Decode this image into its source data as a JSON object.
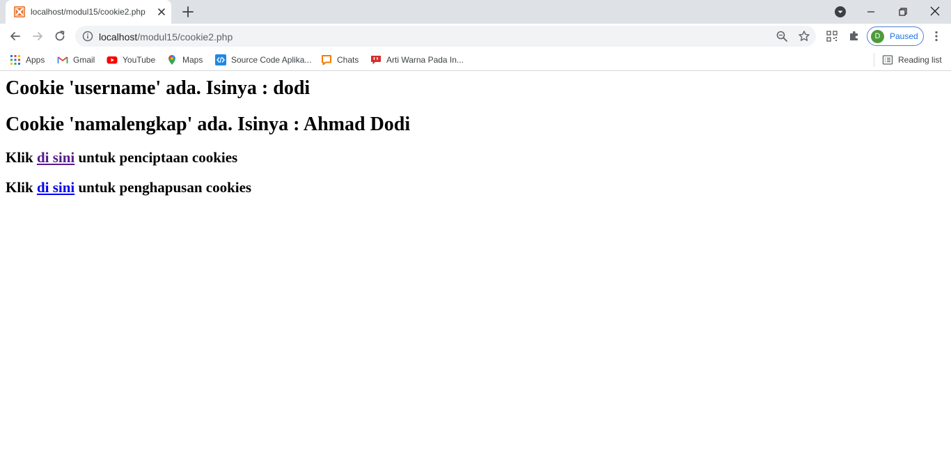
{
  "tab": {
    "title": "localhost/modul15/cookie2.php"
  },
  "address_bar": {
    "host": "localhost",
    "path": "/modul15/cookie2.php"
  },
  "profile": {
    "initial": "D",
    "status": "Paused"
  },
  "bookmarks": [
    {
      "label": "Apps",
      "icon": "apps-grid-icon"
    },
    {
      "label": "Gmail",
      "icon": "gmail-icon"
    },
    {
      "label": "YouTube",
      "icon": "youtube-icon"
    },
    {
      "label": "Maps",
      "icon": "maps-icon"
    },
    {
      "label": "Source Code Aplika...",
      "icon": "source-code-icon"
    },
    {
      "label": "Chats",
      "icon": "chats-icon"
    },
    {
      "label": "Arti Warna Pada In...",
      "icon": "arti-warna-icon"
    }
  ],
  "reading_list": {
    "label": "Reading list"
  },
  "page": {
    "heading1": "Cookie 'username' ada. Isinya : dodi",
    "heading2": "Cookie 'namalengkap' ada. Isinya : Ahmad Dodi",
    "line1": {
      "prefix": "Klik",
      "link": "di sini",
      "suffix": "untuk penciptaan cookies"
    },
    "line2": {
      "prefix": "Klik",
      "link": "di sini",
      "suffix": "untuk penghapusan cookies"
    }
  },
  "colors": {
    "tabstrip_bg": "#dee1e6",
    "omnibox_bg": "#f1f3f4",
    "visited_link": "#551a8b",
    "unvisited_link": "#0000ee",
    "accent": "#1a73e8",
    "avatar": "#4d9b3a"
  }
}
